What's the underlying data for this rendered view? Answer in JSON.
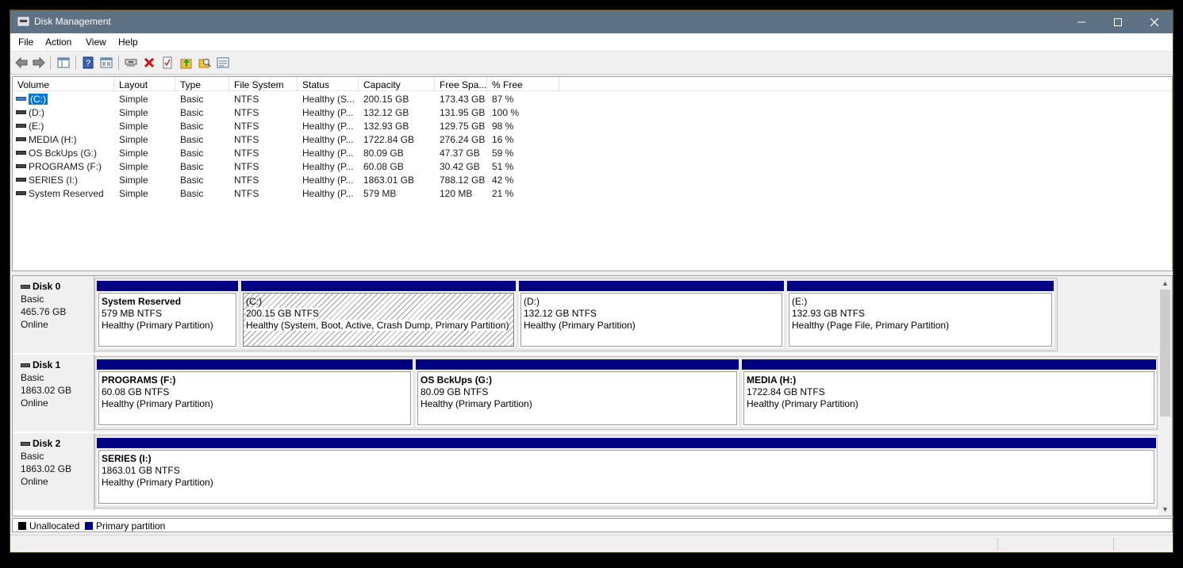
{
  "window": {
    "title": "Disk Management"
  },
  "menu": [
    "File",
    "Action",
    "View",
    "Help"
  ],
  "toolbar": {
    "icons": [
      "back-arrow-icon",
      "forward-arrow-icon",
      "console-tree-icon",
      "help-icon",
      "properties-icon",
      "connect-disk-icon",
      "delete-icon",
      "check-disk-icon",
      "up-folder-icon",
      "explore-icon",
      "settings-icon"
    ]
  },
  "volume_list": {
    "columns": [
      "Volume",
      "Layout",
      "Type",
      "File System",
      "Status",
      "Capacity",
      "Free Spa...",
      "% Free"
    ],
    "rows": [
      [
        "(C:)",
        "Simple",
        "Basic",
        "NTFS",
        "Healthy (S...",
        "200.15 GB",
        "173.43 GB",
        "87 %"
      ],
      [
        "(D:)",
        "Simple",
        "Basic",
        "NTFS",
        "Healthy (P...",
        "132.12 GB",
        "131.95 GB",
        "100 %"
      ],
      [
        "(E:)",
        "Simple",
        "Basic",
        "NTFS",
        "Healthy (P...",
        "132.93 GB",
        "129.75 GB",
        "98 %"
      ],
      [
        "MEDIA (H:)",
        "Simple",
        "Basic",
        "NTFS",
        "Healthy (P...",
        "1722.84 GB",
        "276.24 GB",
        "16 %"
      ],
      [
        "OS BckUps (G:)",
        "Simple",
        "Basic",
        "NTFS",
        "Healthy (P...",
        "80.09 GB",
        "47.37 GB",
        "59 %"
      ],
      [
        "PROGRAMS (F:)",
        "Simple",
        "Basic",
        "NTFS",
        "Healthy (P...",
        "60.08 GB",
        "30.42 GB",
        "51 %"
      ],
      [
        "SERIES (I:)",
        "Simple",
        "Basic",
        "NTFS",
        "Healthy (P...",
        "1863.01 GB",
        "788.12 GB",
        "42 %"
      ],
      [
        "System Reserved",
        "Simple",
        "Basic",
        "NTFS",
        "Healthy (P...",
        "579 MB",
        "120 MB",
        "21 %"
      ]
    ],
    "selected_row": 0
  },
  "disks": [
    {
      "name": "Disk 0",
      "type": "Basic",
      "size": "465.76 GB",
      "status": "Online",
      "partitions": [
        {
          "name": "System Reserved",
          "size": "579 MB NTFS",
          "status": "Healthy (Primary Partition)",
          "bold": true,
          "selected": false
        },
        {
          "name": "(C:)",
          "size": "200.15 GB NTFS",
          "status": "Healthy (System, Boot, Active, Crash Dump, Primary Partition)",
          "bold": false,
          "selected": true
        },
        {
          "name": "(D:)",
          "size": "132.12 GB NTFS",
          "status": "Healthy (Primary Partition)",
          "bold": false,
          "selected": false
        },
        {
          "name": "(E:)",
          "size": "132.93 GB NTFS",
          "status": "Healthy (Page File, Primary Partition)",
          "bold": false,
          "selected": false
        }
      ]
    },
    {
      "name": "Disk 1",
      "type": "Basic",
      "size": "1863.02 GB",
      "status": "Online",
      "partitions": [
        {
          "name": "PROGRAMS  (F:)",
          "size": "60.08 GB NTFS",
          "status": "Healthy (Primary Partition)",
          "bold": true,
          "selected": false
        },
        {
          "name": "OS BckUps  (G:)",
          "size": "80.09 GB NTFS",
          "status": "Healthy (Primary Partition)",
          "bold": true,
          "selected": false
        },
        {
          "name": "MEDIA  (H:)",
          "size": "1722.84 GB NTFS",
          "status": "Healthy (Primary Partition)",
          "bold": true,
          "selected": false
        }
      ]
    },
    {
      "name": "Disk 2",
      "type": "Basic",
      "size": "1863.02 GB",
      "status": "Online",
      "partitions": [
        {
          "name": "SERIES  (I:)",
          "size": "1863.01 GB NTFS",
          "status": "Healthy (Primary Partition)",
          "bold": true,
          "selected": false
        }
      ]
    }
  ],
  "legend": [
    {
      "label": "Unallocated",
      "color": "#000000"
    },
    {
      "label": "Primary partition",
      "color": "#000080"
    }
  ],
  "colors": {
    "titlebar": "#5f7184",
    "partition_bar": "#000080",
    "selection": "#0078d7"
  }
}
